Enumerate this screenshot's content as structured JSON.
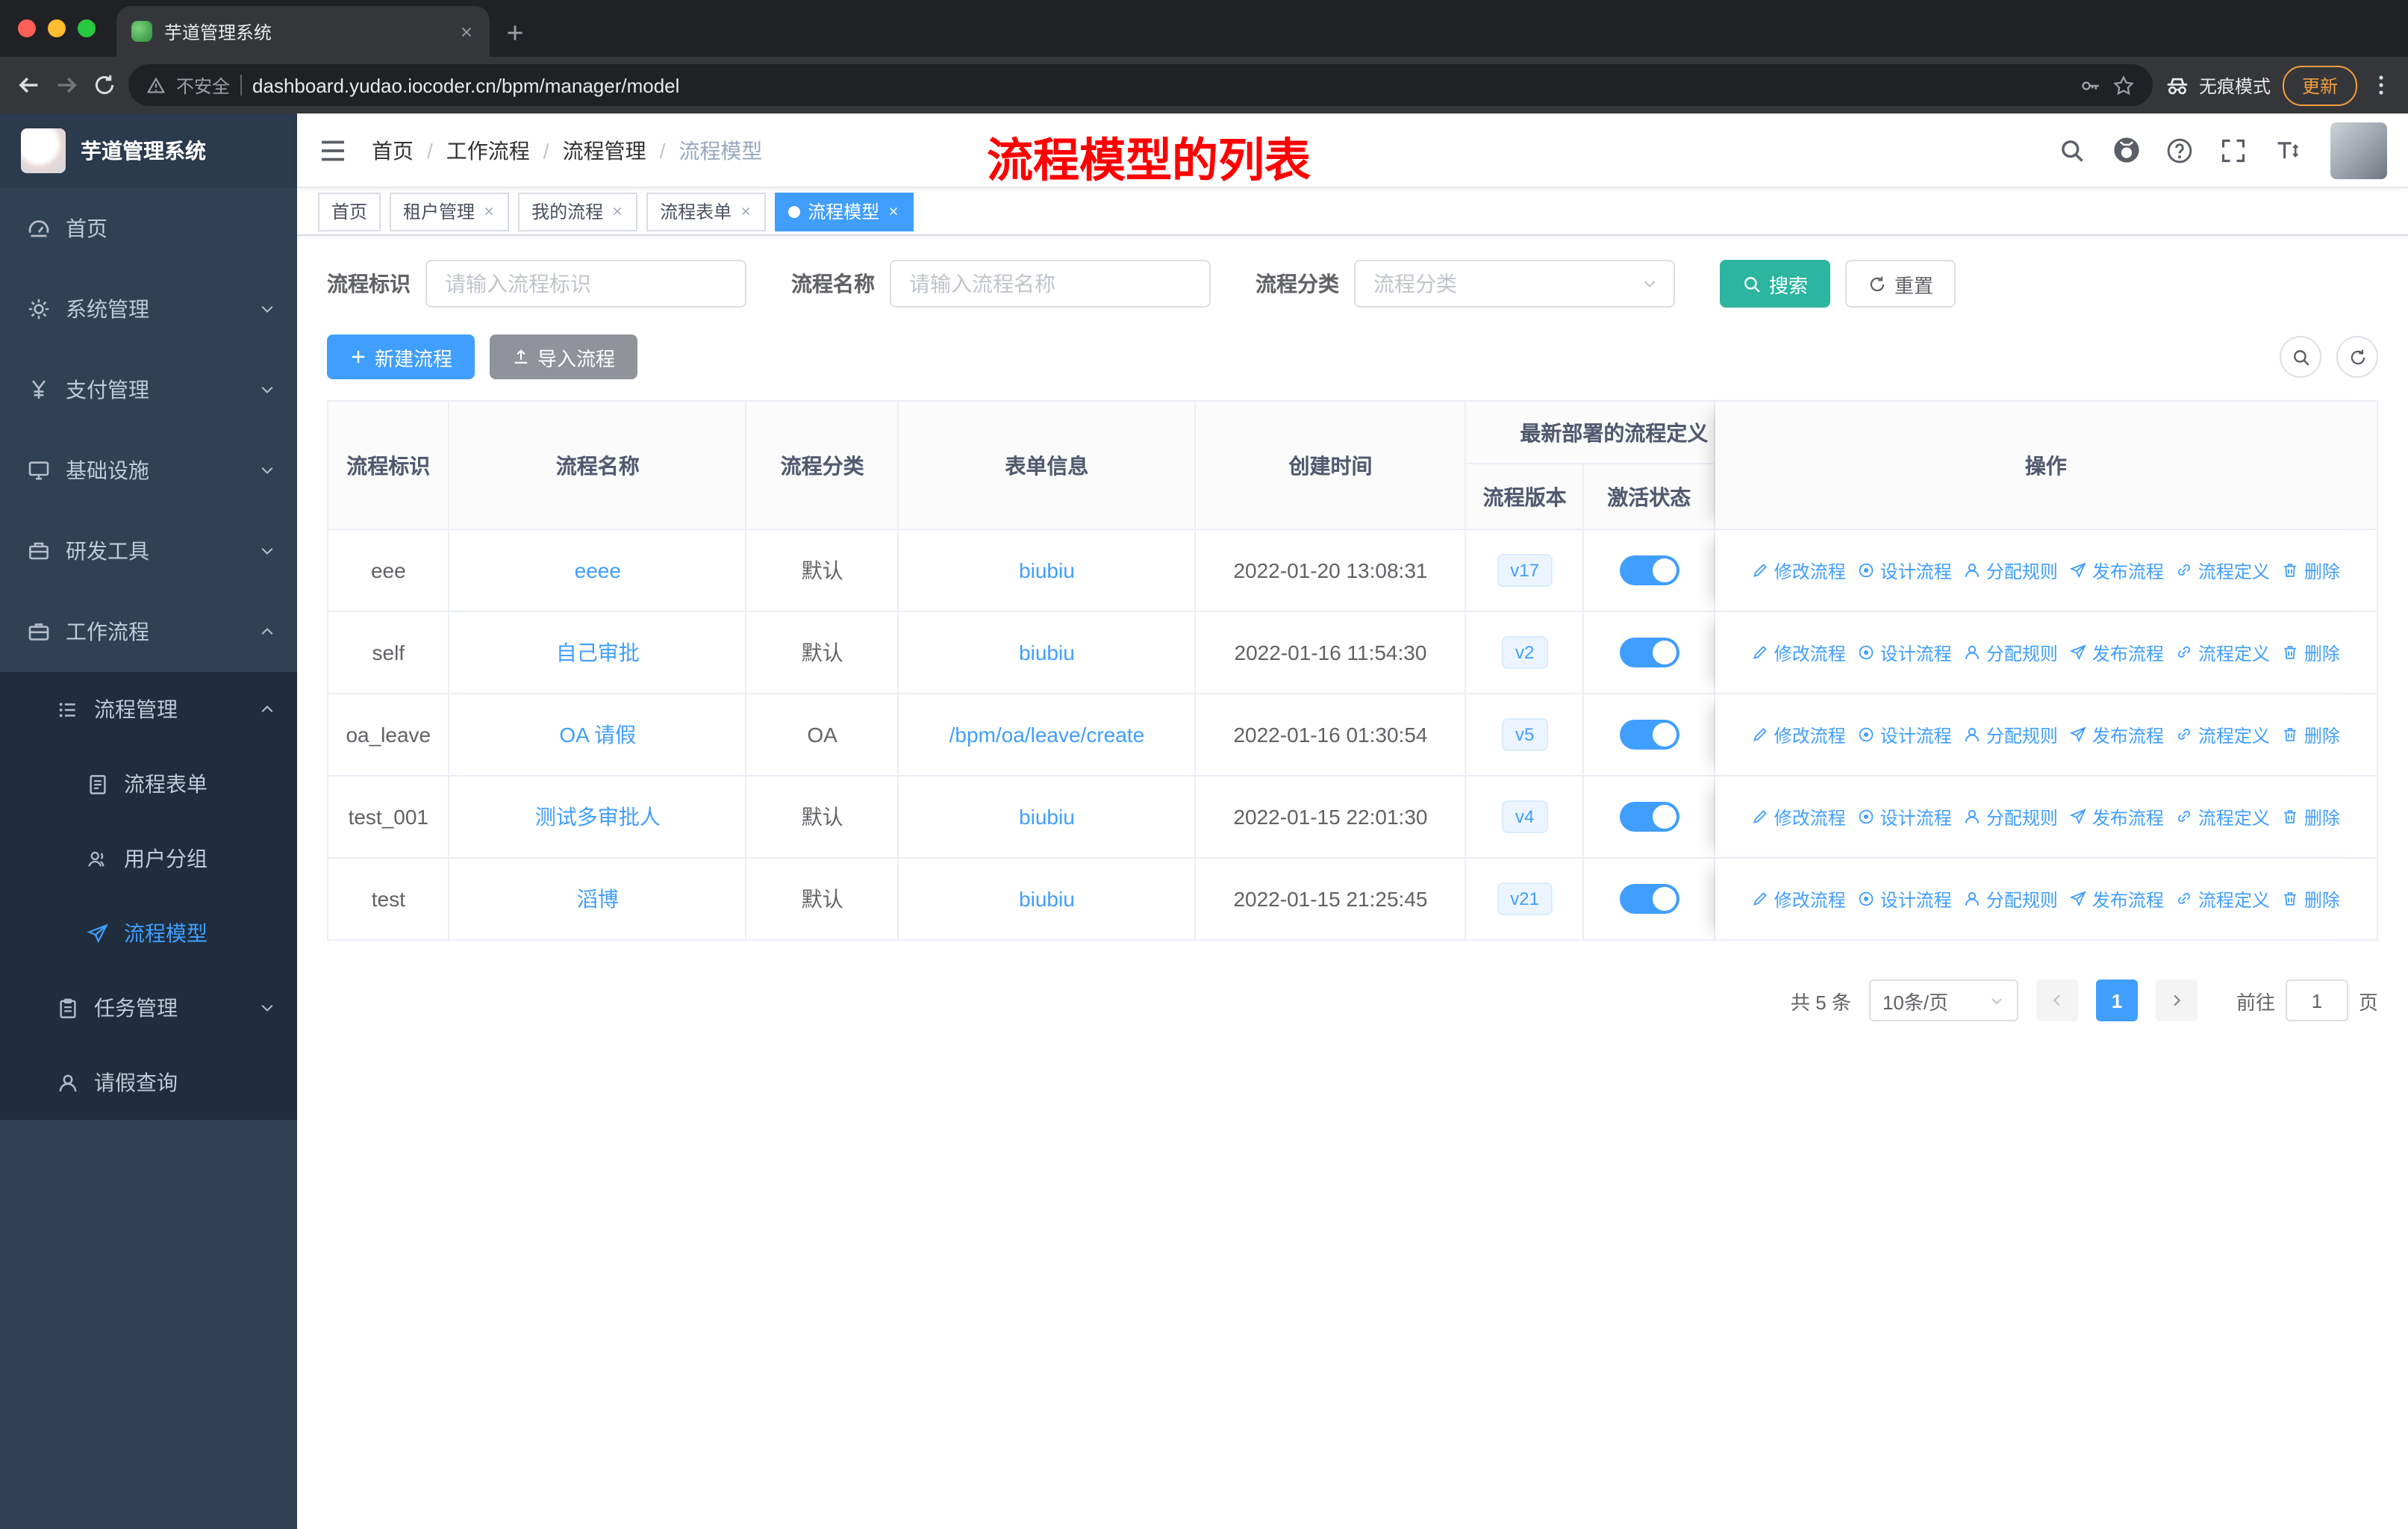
{
  "colors": {
    "accent_blue": "#409eff",
    "search_button_teal": "#2cb5a1",
    "annotation_red": "#ff0000",
    "sidebar_bg": "#304156",
    "submenu_bg": "#1f2d3d",
    "import_button_gray": "#909399"
  },
  "browser": {
    "tab_title": "芋道管理系统",
    "security_label": "不安全",
    "url": "dashboard.yudao.iocoder.cn/bpm/manager/model",
    "incognito_label": "无痕模式",
    "update_label": "更新"
  },
  "sidebar": {
    "title": "芋道管理系统",
    "items": [
      {
        "label": "首页",
        "icon": "dashboard-icon"
      },
      {
        "label": "系统管理",
        "icon": "gear-icon"
      },
      {
        "label": "支付管理",
        "icon": "yen-icon"
      },
      {
        "label": "基础设施",
        "icon": "monitor-icon"
      },
      {
        "label": "研发工具",
        "icon": "toolbox-icon"
      },
      {
        "label": "工作流程",
        "icon": "briefcase-icon"
      }
    ],
    "submenu": {
      "group_label": "流程管理",
      "group_icon": "list-icon",
      "items": [
        {
          "label": "流程表单",
          "icon": "form-icon"
        },
        {
          "label": "用户分组",
          "icon": "users-icon"
        },
        {
          "label": "流程模型",
          "icon": "paper-plane-icon",
          "active": true
        }
      ],
      "tail": [
        {
          "label": "任务管理",
          "icon": "clipboard-icon"
        },
        {
          "label": "请假查询",
          "icon": "person-icon"
        }
      ]
    }
  },
  "header": {
    "breadcrumb": [
      "首页",
      "工作流程",
      "流程管理",
      "流程模型"
    ],
    "annotation": "流程模型的列表"
  },
  "tags": [
    {
      "label": "首页"
    },
    {
      "label": "租户管理"
    },
    {
      "label": "我的流程"
    },
    {
      "label": "流程表单"
    },
    {
      "label": "流程模型",
      "active": true
    }
  ],
  "filters": {
    "id_label": "流程标识",
    "id_placeholder": "请输入流程标识",
    "name_label": "流程名称",
    "name_placeholder": "请输入流程名称",
    "category_label": "流程分类",
    "category_placeholder": "流程分类",
    "search_label": "搜索",
    "reset_label": "重置"
  },
  "toolbar": {
    "create_label": "新建流程",
    "import_label": "导入流程"
  },
  "table": {
    "headers": {
      "id": "流程标识",
      "name": "流程名称",
      "category": "流程分类",
      "form": "表单信息",
      "created": "创建时间",
      "deploy_group": "最新部署的流程定义",
      "version": "流程版本",
      "status": "激活状态",
      "actions": "操作"
    },
    "action_labels": [
      {
        "label": "修改流程",
        "icon": "edit-icon"
      },
      {
        "label": "设计流程",
        "icon": "design-icon"
      },
      {
        "label": "分配规则",
        "icon": "assign-user-icon"
      },
      {
        "label": "发布流程",
        "icon": "publish-icon"
      },
      {
        "label": "流程定义",
        "icon": "definition-link-icon"
      },
      {
        "label": "删除",
        "icon": "delete-icon"
      }
    ],
    "rows": [
      {
        "id": "eee",
        "name": "eeee",
        "category": "默认",
        "form": "biubiu",
        "created": "2022-01-20 13:08:31",
        "version": "v17",
        "active": true
      },
      {
        "id": "self",
        "name": "自己审批",
        "category": "默认",
        "form": "biubiu",
        "created": "2022-01-16 11:54:30",
        "version": "v2",
        "active": true
      },
      {
        "id": "oa_leave",
        "name": "OA 请假",
        "category": "OA",
        "form": "/bpm/oa/leave/create",
        "created": "2022-01-16 01:30:54",
        "version": "v5",
        "active": true
      },
      {
        "id": "test_001",
        "name": "测试多审批人",
        "category": "默认",
        "form": "biubiu",
        "created": "2022-01-15 22:01:30",
        "version": "v4",
        "active": true
      },
      {
        "id": "test",
        "name": "滔博",
        "category": "默认",
        "form": "biubiu",
        "created": "2022-01-15 21:25:45",
        "version": "v21",
        "active": true
      }
    ]
  },
  "pagination": {
    "total": "共 5 条",
    "page_size": "10条/页",
    "current_page": "1",
    "goto_label": "前往",
    "goto_value": "1",
    "unit_label": "页"
  }
}
